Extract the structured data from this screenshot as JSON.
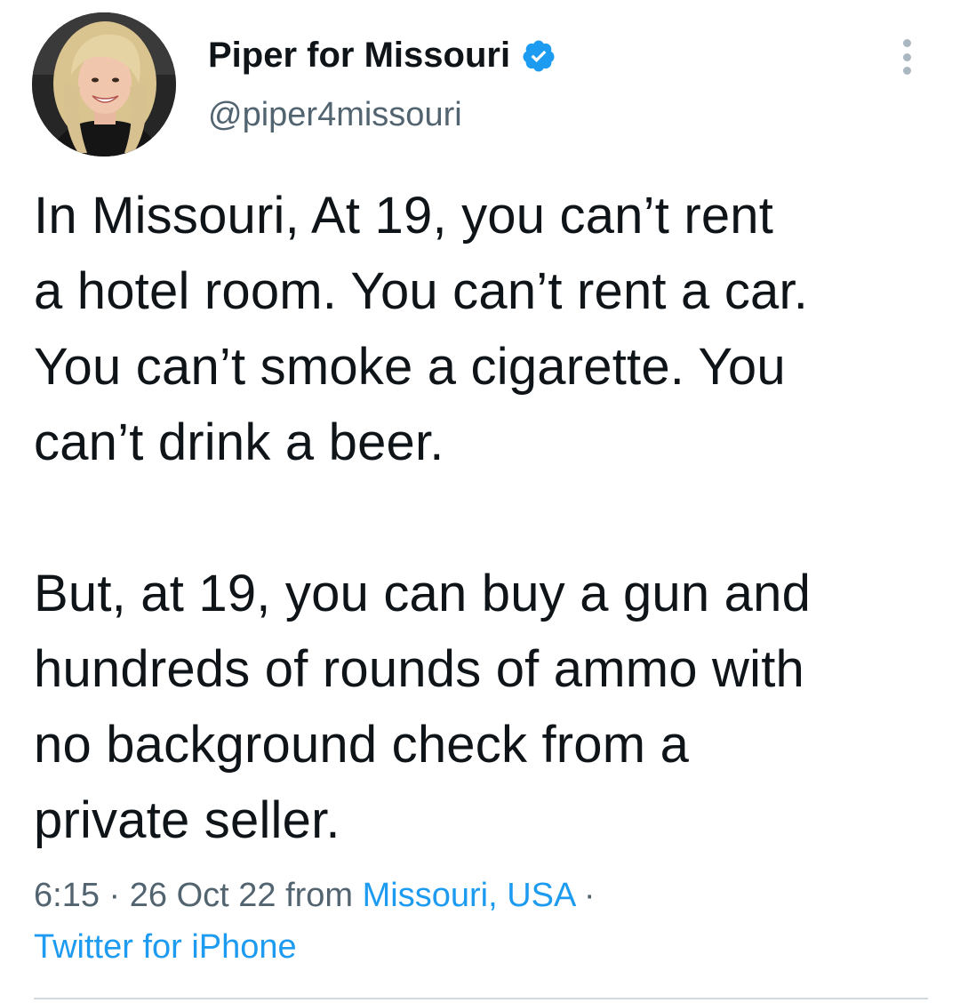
{
  "tweet": {
    "author": {
      "display_name": "Piper for Missouri",
      "handle": "@piper4missouri",
      "verified": true,
      "avatar": "profile-photo"
    },
    "text": "In Missouri, At 19, you can’t rent\na hotel room. You can’t rent a car.\nYou can’t smoke a cigarette. You\ncan’t drink a beer.\n\nBut, at 19, you can buy a gun and\nhundreds of rounds of ammo with\nno background check from a\nprivate seller.",
    "time": "6:15",
    "separator": " · ",
    "date": "26 Oct 22",
    "from_label": " from ",
    "location": "Missouri, USA",
    "trailing_separator": " ·",
    "source": "Twitter for iPhone"
  },
  "icons": {
    "verified": "verified-badge-icon",
    "more": "more-options-icon"
  },
  "colors": {
    "text": "#0f1419",
    "secondary": "#536471",
    "link": "#1d9bf0",
    "divider": "#cfd9de"
  }
}
